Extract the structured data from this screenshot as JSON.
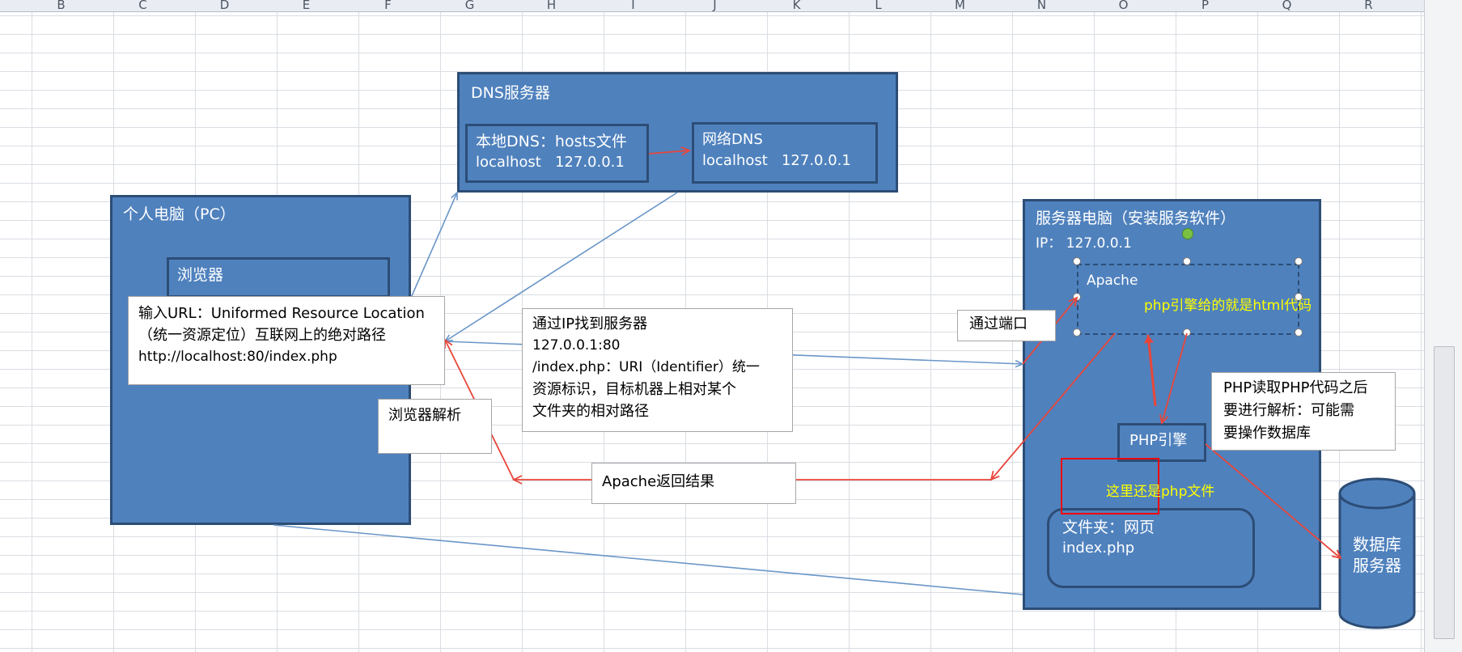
{
  "columns": [
    "B",
    "C",
    "D",
    "E",
    "F",
    "G",
    "H",
    "I",
    "J",
    "K",
    "L",
    "M",
    "N",
    "O",
    "P",
    "Q",
    "R"
  ],
  "dns_server": {
    "title": "DNS服务器",
    "local_line1": "本地DNS：hosts文件",
    "local_line2": "localhost   127.0.0.1",
    "net_line1": "网络DNS",
    "net_line2": "localhost   127.0.0.1"
  },
  "pc": {
    "title": "个人电脑（PC）",
    "browser": "浏览器"
  },
  "url_note": {
    "line1": "输入URL：Uniformed Resource Location",
    "line2": "（统一资源定位）互联网上的绝对路径",
    "line3": "http://localhost:80/index.php"
  },
  "ip_note": {
    "line1": "通过IP找到服务器",
    "line2": "127.0.0.1:80",
    "line3": "/index.php：URI（Identifier）统一",
    "line4": "资源标识，目标机器上相对某个",
    "line5": "文件夹的相对路径"
  },
  "browser_parse": "浏览器解析",
  "apache_return": "Apache返回结果",
  "port_note": "通过端口",
  "server": {
    "title": "服务器电脑（安装服务软件）",
    "ip": "IP：  127.0.0.1",
    "apache": "Apache",
    "apache_note": "php引擎给的就是html代码",
    "php_engine": "PHP引擎",
    "still_php": "这里还是php文件",
    "folder_line1": "文件夹：网页",
    "folder_line2": "index.php"
  },
  "php_note": {
    "line1": "PHP读取PHP代码之后",
    "line2": "要进行解析：可能需",
    "line3": "要操作数据库"
  },
  "database": {
    "line1": "数据库",
    "line2": "服务器"
  },
  "colors": {
    "box_fill": "#4f81bd",
    "box_border": "#2c4d76",
    "arrow_blue": "#6a96c8",
    "arrow_red": "#e8463a",
    "highlight_yellow": "#ffff00"
  }
}
